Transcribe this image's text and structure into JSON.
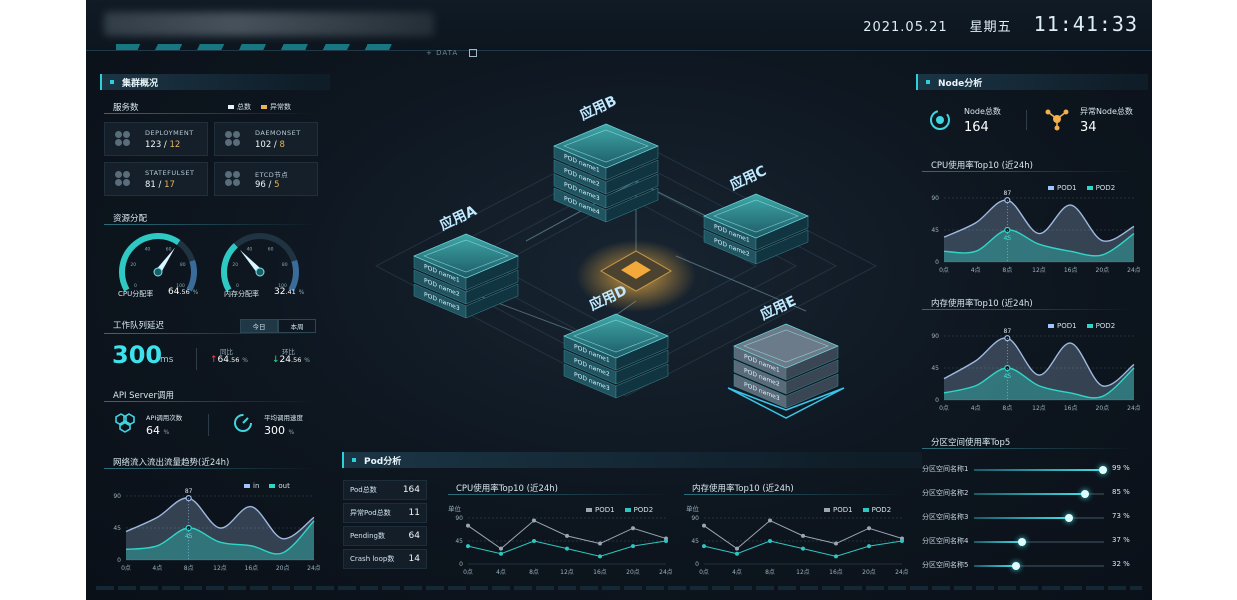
{
  "header": {
    "date": "2021.05.21",
    "weekday": "星期五",
    "time": "11:41:33",
    "data_tag": "+ DATA"
  },
  "cluster": {
    "title": "集群概况",
    "services_title": "服务数",
    "legend_total": "总数",
    "legend_abnormal": "异常数",
    "cards": [
      {
        "label": "DEPLOYMENT",
        "total": "123",
        "abnormal": "12"
      },
      {
        "label": "DAEMONSET",
        "total": "102",
        "abnormal": "8"
      },
      {
        "label": "STATEFULSET",
        "total": "81",
        "abnormal": "17"
      },
      {
        "label": "ETCD节点",
        "total": "96",
        "abnormal": "5"
      }
    ],
    "resource_title": "资源分配",
    "cpu_label": "CPU分配率",
    "cpu_value": "64",
    "cpu_dec": ".56",
    "cpu_pct": 64.56,
    "mem_label": "内存分配率",
    "mem_value": "32",
    "mem_dec": ".41",
    "mem_pct": 32.41,
    "gauge_ticks": [
      "0",
      "20",
      "40",
      "60",
      "80",
      "100"
    ],
    "queue_title": "工作队列延迟",
    "tab_today": "今日",
    "tab_week": "本周",
    "queue_value": "300",
    "queue_unit": "ms",
    "yoy_label": "同比",
    "yoy_value": "64",
    "yoy_dec": ".56",
    "mom_label": "环比",
    "mom_value": "24",
    "mom_dec": ".56",
    "pct_sign": "%",
    "api_title": "API Server调用",
    "api_calls_label": "API调用次数",
    "api_calls_value": "64",
    "api_speed_label": "平均调用速度",
    "api_speed_value": "300",
    "net_title": "网络流入流出流量趋势(近24h)",
    "net_legend_in": "in",
    "net_legend_out": "out"
  },
  "apps": [
    {
      "name": "应用A",
      "pods": [
        "POD name1",
        "POD name2",
        "POD name3"
      ]
    },
    {
      "name": "应用B",
      "pods": [
        "POD name1",
        "POD name2",
        "POD name3",
        "POD name4"
      ]
    },
    {
      "name": "应用C",
      "pods": [
        "POD name1",
        "POD name2"
      ]
    },
    {
      "name": "应用D",
      "pods": [
        "POD name1",
        "POD name2",
        "POD name3"
      ]
    },
    {
      "name": "应用E",
      "pods": [
        "POD name1",
        "POD name2",
        "POD name3"
      ]
    }
  ],
  "pod": {
    "title": "Pod分析",
    "stats": [
      {
        "label": "Pod总数",
        "value": "164"
      },
      {
        "label": "异常Pod总数",
        "value": "11"
      },
      {
        "label": "Pending数",
        "value": "64"
      },
      {
        "label": "Crash loop数",
        "value": "14"
      }
    ],
    "cpu_chart_title": "CPU使用率Top10 (近24h)",
    "mem_chart_title": "内存使用率Top10 (近24h)",
    "unit_label": "单位",
    "legend_pod1": "POD1",
    "legend_pod2": "POD2"
  },
  "node": {
    "title": "Node分析",
    "total_label": "Node总数",
    "total_value": "164",
    "abnormal_label": "异常Node总数",
    "abnormal_value": "34",
    "cpu_title": "CPU使用率Top10 (近24h)",
    "mem_title": "内存使用率Top10 (近24h)",
    "legend_pod1": "POD1",
    "legend_pod2": "POD2",
    "partition_title": "分区空间使用率Top5",
    "partitions": [
      {
        "name": "分区空间名称1",
        "pct": 99,
        "label": "99 %"
      },
      {
        "name": "分区空间名称2",
        "pct": 85,
        "label": "85 %"
      },
      {
        "name": "分区空间名称3",
        "pct": 73,
        "label": "73 %"
      },
      {
        "name": "分区空间名称4",
        "pct": 37,
        "label": "37 %"
      },
      {
        "name": "分区空间名称5",
        "pct": 32,
        "label": "32 %"
      }
    ]
  },
  "chart_data": [
    {
      "type": "area",
      "id": "net",
      "x": [
        "0点",
        "4点",
        "8点",
        "12点",
        "16点",
        "20点",
        "24点"
      ],
      "series": [
        {
          "name": "in",
          "values": [
            40,
            60,
            87,
            45,
            75,
            30,
            60
          ]
        },
        {
          "name": "out",
          "values": [
            15,
            20,
            45,
            25,
            20,
            10,
            55
          ]
        }
      ],
      "yticks": [
        0,
        45,
        90
      ],
      "ylim": [
        0,
        90
      ],
      "annotations": [
        "87",
        "45"
      ]
    },
    {
      "type": "area",
      "id": "node_cpu",
      "x": [
        "0点",
        "4点",
        "8点",
        "12点",
        "16点",
        "20点",
        "24点"
      ],
      "series": [
        {
          "name": "POD1",
          "values": [
            35,
            55,
            87,
            40,
            80,
            30,
            50
          ]
        },
        {
          "name": "POD2",
          "values": [
            15,
            15,
            45,
            25,
            15,
            10,
            40
          ]
        }
      ],
      "yticks": [
        0,
        45,
        90
      ],
      "ylim": [
        0,
        90
      ],
      "annotations": [
        "87",
        "45"
      ]
    },
    {
      "type": "area",
      "id": "node_mem",
      "x": [
        "0点",
        "4点",
        "8点",
        "12点",
        "16点",
        "20点",
        "24点"
      ],
      "series": [
        {
          "name": "POD1",
          "values": [
            30,
            55,
            87,
            35,
            80,
            20,
            50
          ]
        },
        {
          "name": "POD2",
          "values": [
            10,
            20,
            45,
            20,
            10,
            5,
            45
          ]
        }
      ],
      "yticks": [
        0,
        45,
        90
      ],
      "ylim": [
        0,
        90
      ],
      "annotations": [
        "87",
        "45"
      ]
    },
    {
      "type": "line",
      "id": "pod_cpu",
      "x": [
        "0点",
        "4点",
        "8点",
        "12点",
        "16点",
        "20点",
        "24点"
      ],
      "series": [
        {
          "name": "POD1",
          "values": [
            75,
            30,
            85,
            55,
            40,
            70,
            50
          ]
        },
        {
          "name": "POD2",
          "values": [
            35,
            20,
            45,
            30,
            15,
            35,
            45
          ]
        }
      ],
      "yticks": [
        0,
        45,
        90
      ],
      "ylim": [
        0,
        90
      ]
    },
    {
      "type": "line",
      "id": "pod_mem",
      "x": [
        "0点",
        "4点",
        "8点",
        "12点",
        "16点",
        "20点",
        "24点"
      ],
      "series": [
        {
          "name": "POD1",
          "values": [
            75,
            30,
            85,
            55,
            40,
            70,
            50
          ]
        },
        {
          "name": "POD2",
          "values": [
            35,
            20,
            45,
            30,
            15,
            35,
            45
          ]
        }
      ],
      "yticks": [
        0,
        45,
        90
      ],
      "ylim": [
        0,
        90
      ]
    }
  ]
}
